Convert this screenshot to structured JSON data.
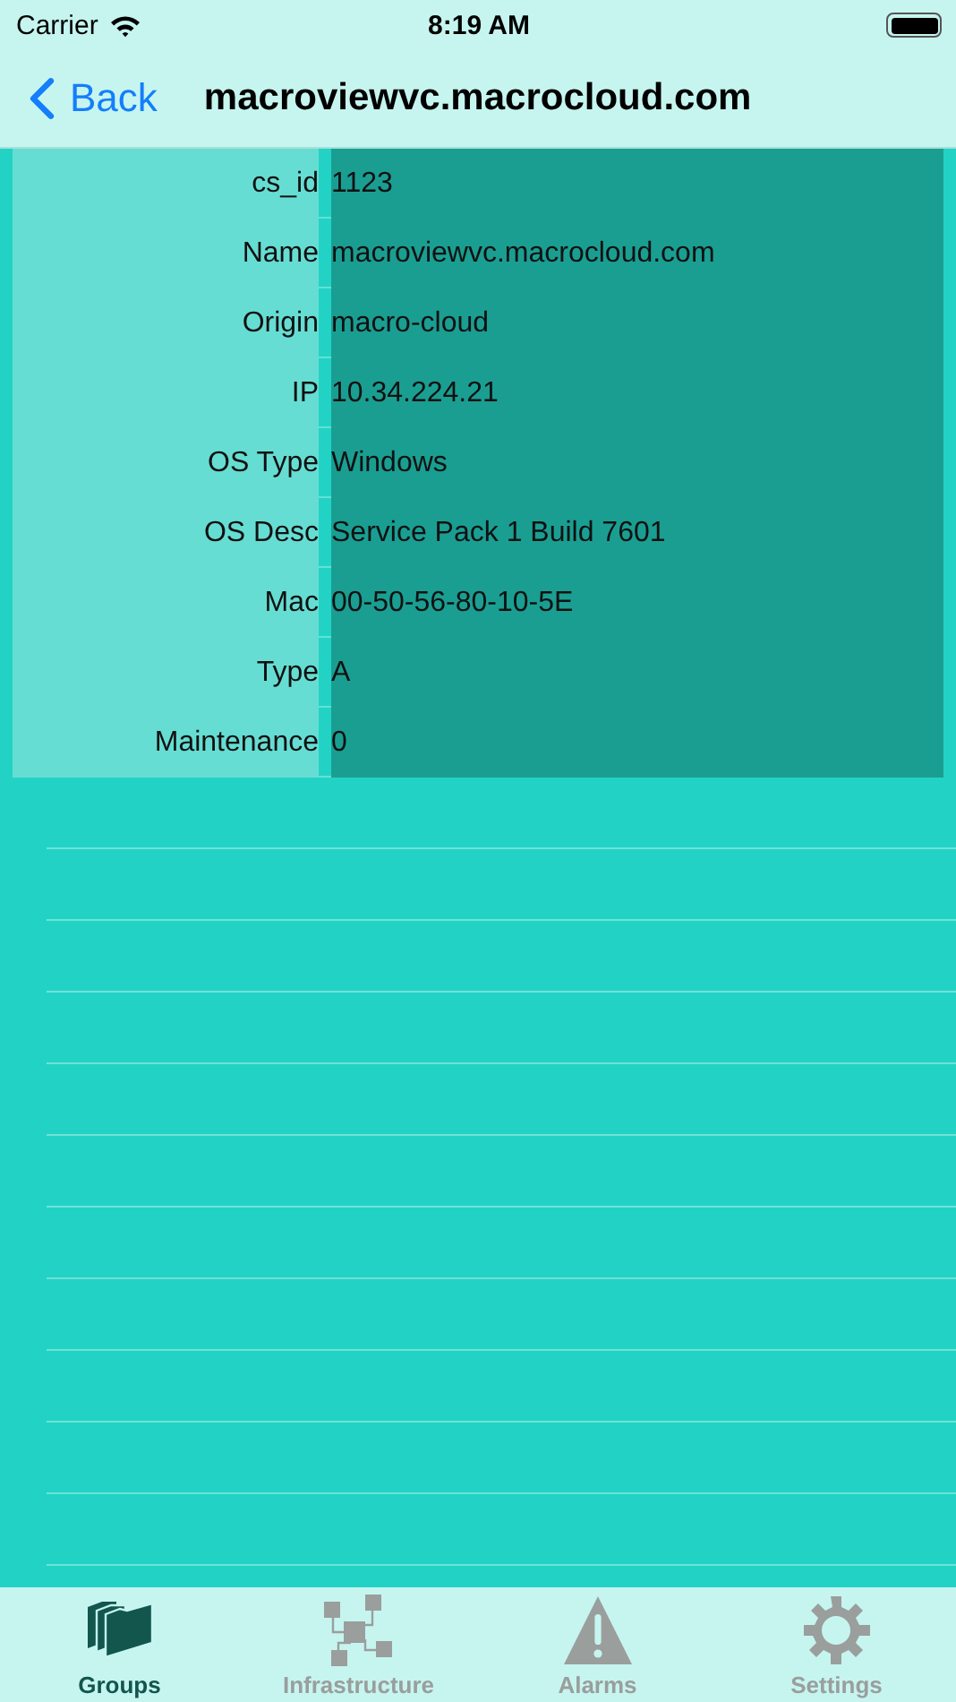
{
  "status_bar": {
    "carrier": "Carrier",
    "time": "8:19 AM"
  },
  "nav": {
    "back": "Back",
    "title": "macroviewvc.macrocloud.com"
  },
  "rows": [
    {
      "label": "cs_id",
      "value": "1123"
    },
    {
      "label": "Name",
      "value": "macroviewvc.macrocloud.com"
    },
    {
      "label": "Origin",
      "value": "macro-cloud"
    },
    {
      "label": "IP",
      "value": "10.34.224.21"
    },
    {
      "label": "OS Type",
      "value": "Windows"
    },
    {
      "label": "OS Desc",
      "value": "Service Pack 1 Build 7601"
    },
    {
      "label": "Mac",
      "value": "00-50-56-80-10-5E"
    },
    {
      "label": "Type",
      "value": "A"
    },
    {
      "label": "Maintenance",
      "value": "0"
    }
  ],
  "tabs": [
    {
      "label": "Groups",
      "kind": "folders",
      "selected": true
    },
    {
      "label": "Infrastructure",
      "kind": "network",
      "selected": false
    },
    {
      "label": "Alarms",
      "kind": "warning",
      "selected": false
    },
    {
      "label": "Settings",
      "kind": "gear",
      "selected": false
    }
  ]
}
